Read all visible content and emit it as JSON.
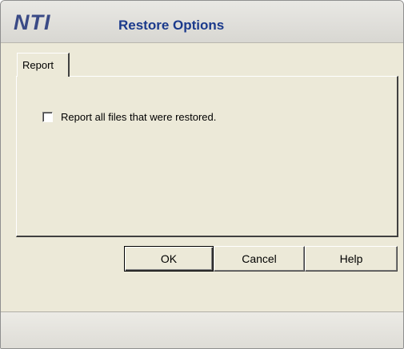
{
  "window": {
    "logo": "NTI",
    "title": "Restore Options"
  },
  "tabs": [
    {
      "label": "Report",
      "active": true
    }
  ],
  "report": {
    "checkbox_label": "Report all files that were restored.",
    "checked": false
  },
  "buttons": {
    "ok": "OK",
    "cancel": "Cancel",
    "help": "Help"
  },
  "colors": {
    "title_blue": "#1b3a8c",
    "logo_blue": "#3a4a86",
    "dialog_bg": "#ece9d8"
  }
}
